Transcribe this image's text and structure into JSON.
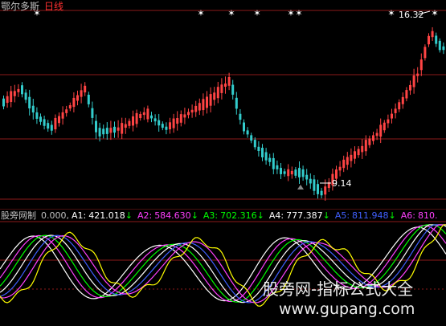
{
  "price_panel": {
    "title": "鄂尔多斯",
    "period": "日线",
    "title_color": "#c0c0c0",
    "period_color": "#ff3030",
    "high_label": "16.32",
    "low_label": "9.14",
    "label_color": "#ffffff",
    "marker_symbol": "✶",
    "grid_color": "#8b1a1a"
  },
  "indicator_panel": {
    "name": "股旁网制",
    "base_value": "0.000,",
    "series": [
      {
        "name": "A1:",
        "value": "421.018",
        "arrow": "↓",
        "color": "#ffffff",
        "arrow_color": "#00ff00"
      },
      {
        "name": "A2:",
        "value": "584.630",
        "arrow": "↓",
        "color": "#ff40ff",
        "arrow_color": "#00ff00"
      },
      {
        "name": "A3:",
        "value": "702.316",
        "arrow": "↓",
        "color": "#00ff00",
        "arrow_color": "#00ff00"
      },
      {
        "name": "A4:",
        "value": "777.387",
        "arrow": "↓",
        "color": "#ffffff",
        "arrow_color": "#00ff00"
      },
      {
        "name": "A5:",
        "value": "811.948",
        "arrow": "↓",
        "color": "#4060ff",
        "arrow_color": "#00ff00"
      },
      {
        "name": "A6:",
        "value": "810.",
        "arrow": "",
        "color": "#ff40ff",
        "arrow_color": "#00ff00"
      }
    ]
  },
  "watermark": {
    "line1": "股旁网-指标公式大全",
    "line2": "www.gupang.com"
  },
  "colors": {
    "up": "#ff4444",
    "down": "#33cccc",
    "background": "#000000"
  }
}
